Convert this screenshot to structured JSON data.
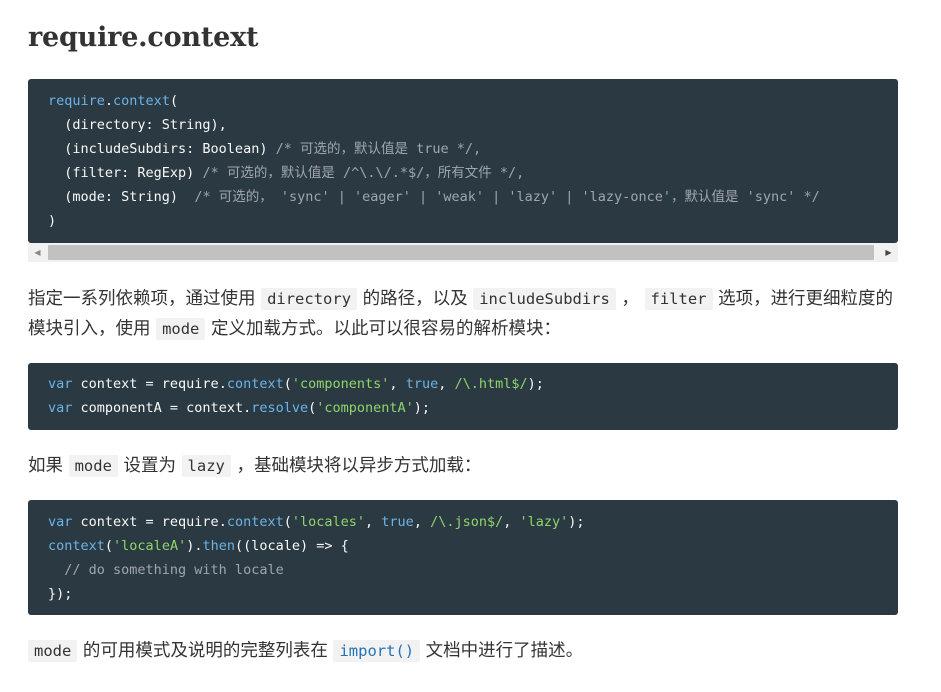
{
  "title": "require.context",
  "code1": {
    "lines": [
      {
        "fn_obj": "require",
        "dot": ".",
        "fn": "context",
        "rest": "("
      },
      {
        "main": "  (directory: String),",
        "comment": ""
      },
      {
        "main": "  (includeSubdirs: Boolean) ",
        "comment": "/* 可选的，默认值是 true */,"
      },
      {
        "main": "  (filter: RegExp) ",
        "comment": "/* 可选的，默认值是 /^\\.\\/.*$/，所有文件 */,"
      },
      {
        "main": "  (mode: String)  ",
        "comment": "/* 可选的， 'sync' | 'eager' | 'weak' | 'lazy' | 'lazy-once'，默认值是 'sync' */"
      },
      {
        "main": ")",
        "comment": ""
      }
    ]
  },
  "para1": {
    "t1": "指定一系列依赖项，通过使用 ",
    "c1": "directory",
    "t2": " 的路径，以及 ",
    "c2": "includeSubdirs",
    "t3": " ， ",
    "c3": "filter",
    "t4": " 选项，进行更细粒度的模块引入，使用 ",
    "c4": "mode",
    "t5": " 定义加载方式。以此可以很容易的解析模块："
  },
  "code2": {
    "l1": {
      "kw": "var",
      "a": " context = require.",
      "fn": "context",
      "b": "(",
      "s1": "'components'",
      "c1": ", ",
      "bool": "true",
      "c2": ", ",
      "re": "/\\.html$/",
      "end": ");"
    },
    "l2": {
      "kw": "var",
      "a": " componentA = context.",
      "fn": "resolve",
      "b": "(",
      "s1": "'componentA'",
      "end": ");"
    }
  },
  "para2": {
    "t1": "如果 ",
    "c1": "mode",
    "t2": " 设置为 ",
    "c2": "lazy",
    "t3": " ，基础模块将以异步方式加载："
  },
  "code3": {
    "l1": {
      "kw": "var",
      "a": " context = require.",
      "fn": "context",
      "b": "(",
      "s1": "'locales'",
      "c1": ", ",
      "bool": "true",
      "c2": ", ",
      "re": "/\\.json$/",
      "c3": ", ",
      "s2": "'lazy'",
      "end": ");"
    },
    "l2": {
      "fn0": "context",
      "b": "(",
      "s1": "'localeA'",
      "c": ").",
      "fn": "then",
      "end": "((locale) => {"
    },
    "l3": {
      "comment": "  // do something with locale"
    },
    "l4": {
      "end": "});"
    }
  },
  "para3": {
    "c1": "mode",
    "t1": " 的可用模式及说明的完整列表在 ",
    "link": "import()",
    "t2": " 文档中进行了描述。"
  }
}
